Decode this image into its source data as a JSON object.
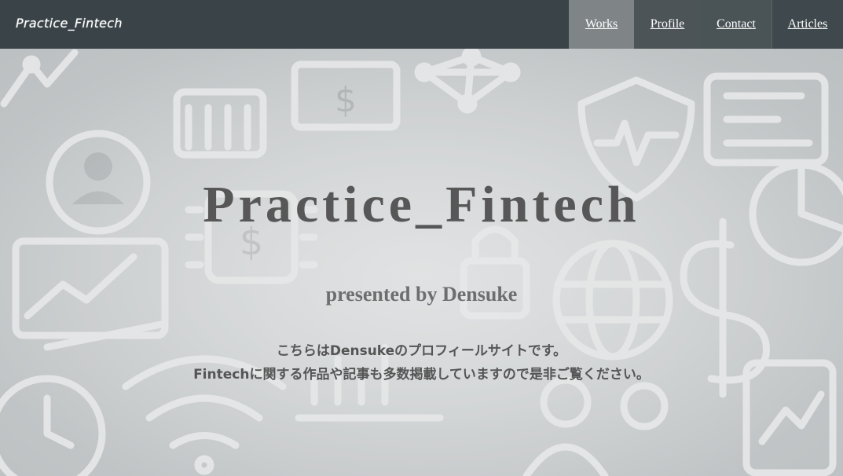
{
  "header": {
    "logo": "Practice_Fintech",
    "nav": [
      {
        "label": "Works"
      },
      {
        "label": "Profile"
      },
      {
        "label": "Contact"
      },
      {
        "label": "Articles"
      }
    ]
  },
  "hero": {
    "title": "Practice_Fintech",
    "subtitle": "presented by Densuke",
    "description_line1": "こちらはDensukeのプロフィールサイトです。",
    "description_line2": "Fintechに関する作品や記事も多数掲載していますので是非ご覧ください。",
    "background_icons": [
      "chart-icon",
      "dollar-icon",
      "network-icon",
      "shield-icon",
      "globe-icon",
      "chip-icon",
      "pie-chart-icon",
      "user-icon",
      "clock-icon",
      "wifi-icon"
    ]
  },
  "colors": {
    "header_bg": "#3a4347",
    "nav_active_bg": "#7f8587",
    "title_color": "#575757"
  }
}
